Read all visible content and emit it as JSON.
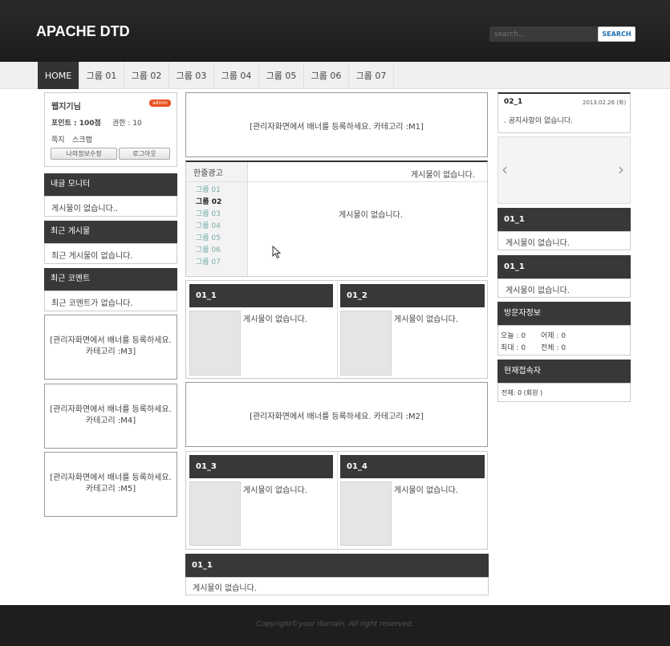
{
  "site": {
    "title": "APACHE DTD"
  },
  "search": {
    "placeholder": "search...",
    "button": "SEARCH"
  },
  "nav": [
    "HOME",
    "그룹 01",
    "그룹 02",
    "그룹 03",
    "그룹 04",
    "그룹 05",
    "그룹 06",
    "그룹 07"
  ],
  "login": {
    "user": "웹지기님",
    "badge": "admin",
    "points": "포인트 : 100점",
    "level": "권한 : 10",
    "memo": "쪽지",
    "scrap": "스크랩",
    "edit": "나의정보수정",
    "logout": "로그아웃"
  },
  "left": {
    "monitor": {
      "title": "내글 모니터",
      "empty": "게시물이 없습니다.."
    },
    "recent_posts": {
      "title": "최근 게시물",
      "empty": "최근 게시물이 없습니다."
    },
    "recent_comments": {
      "title": "최근 코멘트",
      "empty": "최근 코멘트가 없습니다."
    },
    "banner_m3": "[관리자화면에서 배너를 등록하세요. 카테고리 :M3]",
    "banner_m4": "[관리자화면에서 배너를 등록하세요. 카테고리 :M4]",
    "banner_m5": "[관리자화면에서 배너를 등록하세요. 카테고리 :M5]"
  },
  "center": {
    "banner_m1": "[관리자화면에서 배너를 등록하세요. 카테고리 :M1]",
    "oneline": {
      "title": "한줄광고",
      "empty": "게시물이 없습니다."
    },
    "groups": [
      "그룹 01",
      "그룹 02",
      "그룹 03",
      "그룹 04",
      "그룹 05",
      "그룹 06",
      "그룹 07"
    ],
    "group_empty": "게시물이 없습니다.",
    "board_01_1": {
      "title": "01_1",
      "empty": "게시물이 없습니다."
    },
    "board_01_2": {
      "title": "01_2",
      "empty": "게시물이 없습니다."
    },
    "banner_m2": "[관리자화면에서 배너를 등록하세요. 카테고리 :M2]",
    "board_01_3": {
      "title": "01_3",
      "empty": "게시물이 없습니다."
    },
    "board_01_4": {
      "title": "01_4",
      "empty": "게시물이 없습니다."
    },
    "bottom_board": {
      "title": "01_1",
      "empty": "게시물이 없습니다."
    }
  },
  "right": {
    "notice": {
      "title": "02_1",
      "date": "2013.02.26 (화)",
      "text": ". 공지사항이 없습니다."
    },
    "slider": {
      "prev": "‹",
      "next": "›"
    },
    "board_a": {
      "title": "01_1",
      "empty": "게시물이 없습니다."
    },
    "board_b": {
      "title": "01_1",
      "empty": "게시물이 없습니다."
    },
    "visitor": {
      "title": "방문자정보",
      "today": "오늘 : 0",
      "yesterday": "어제 : 0",
      "max": "최대 : 0",
      "total": "전체 : 0"
    },
    "current": {
      "title": "현재접속자",
      "text": "전체: 0 (회원 )"
    }
  },
  "footer": {
    "copyright": "Copyright©your domain. All right reserved."
  }
}
